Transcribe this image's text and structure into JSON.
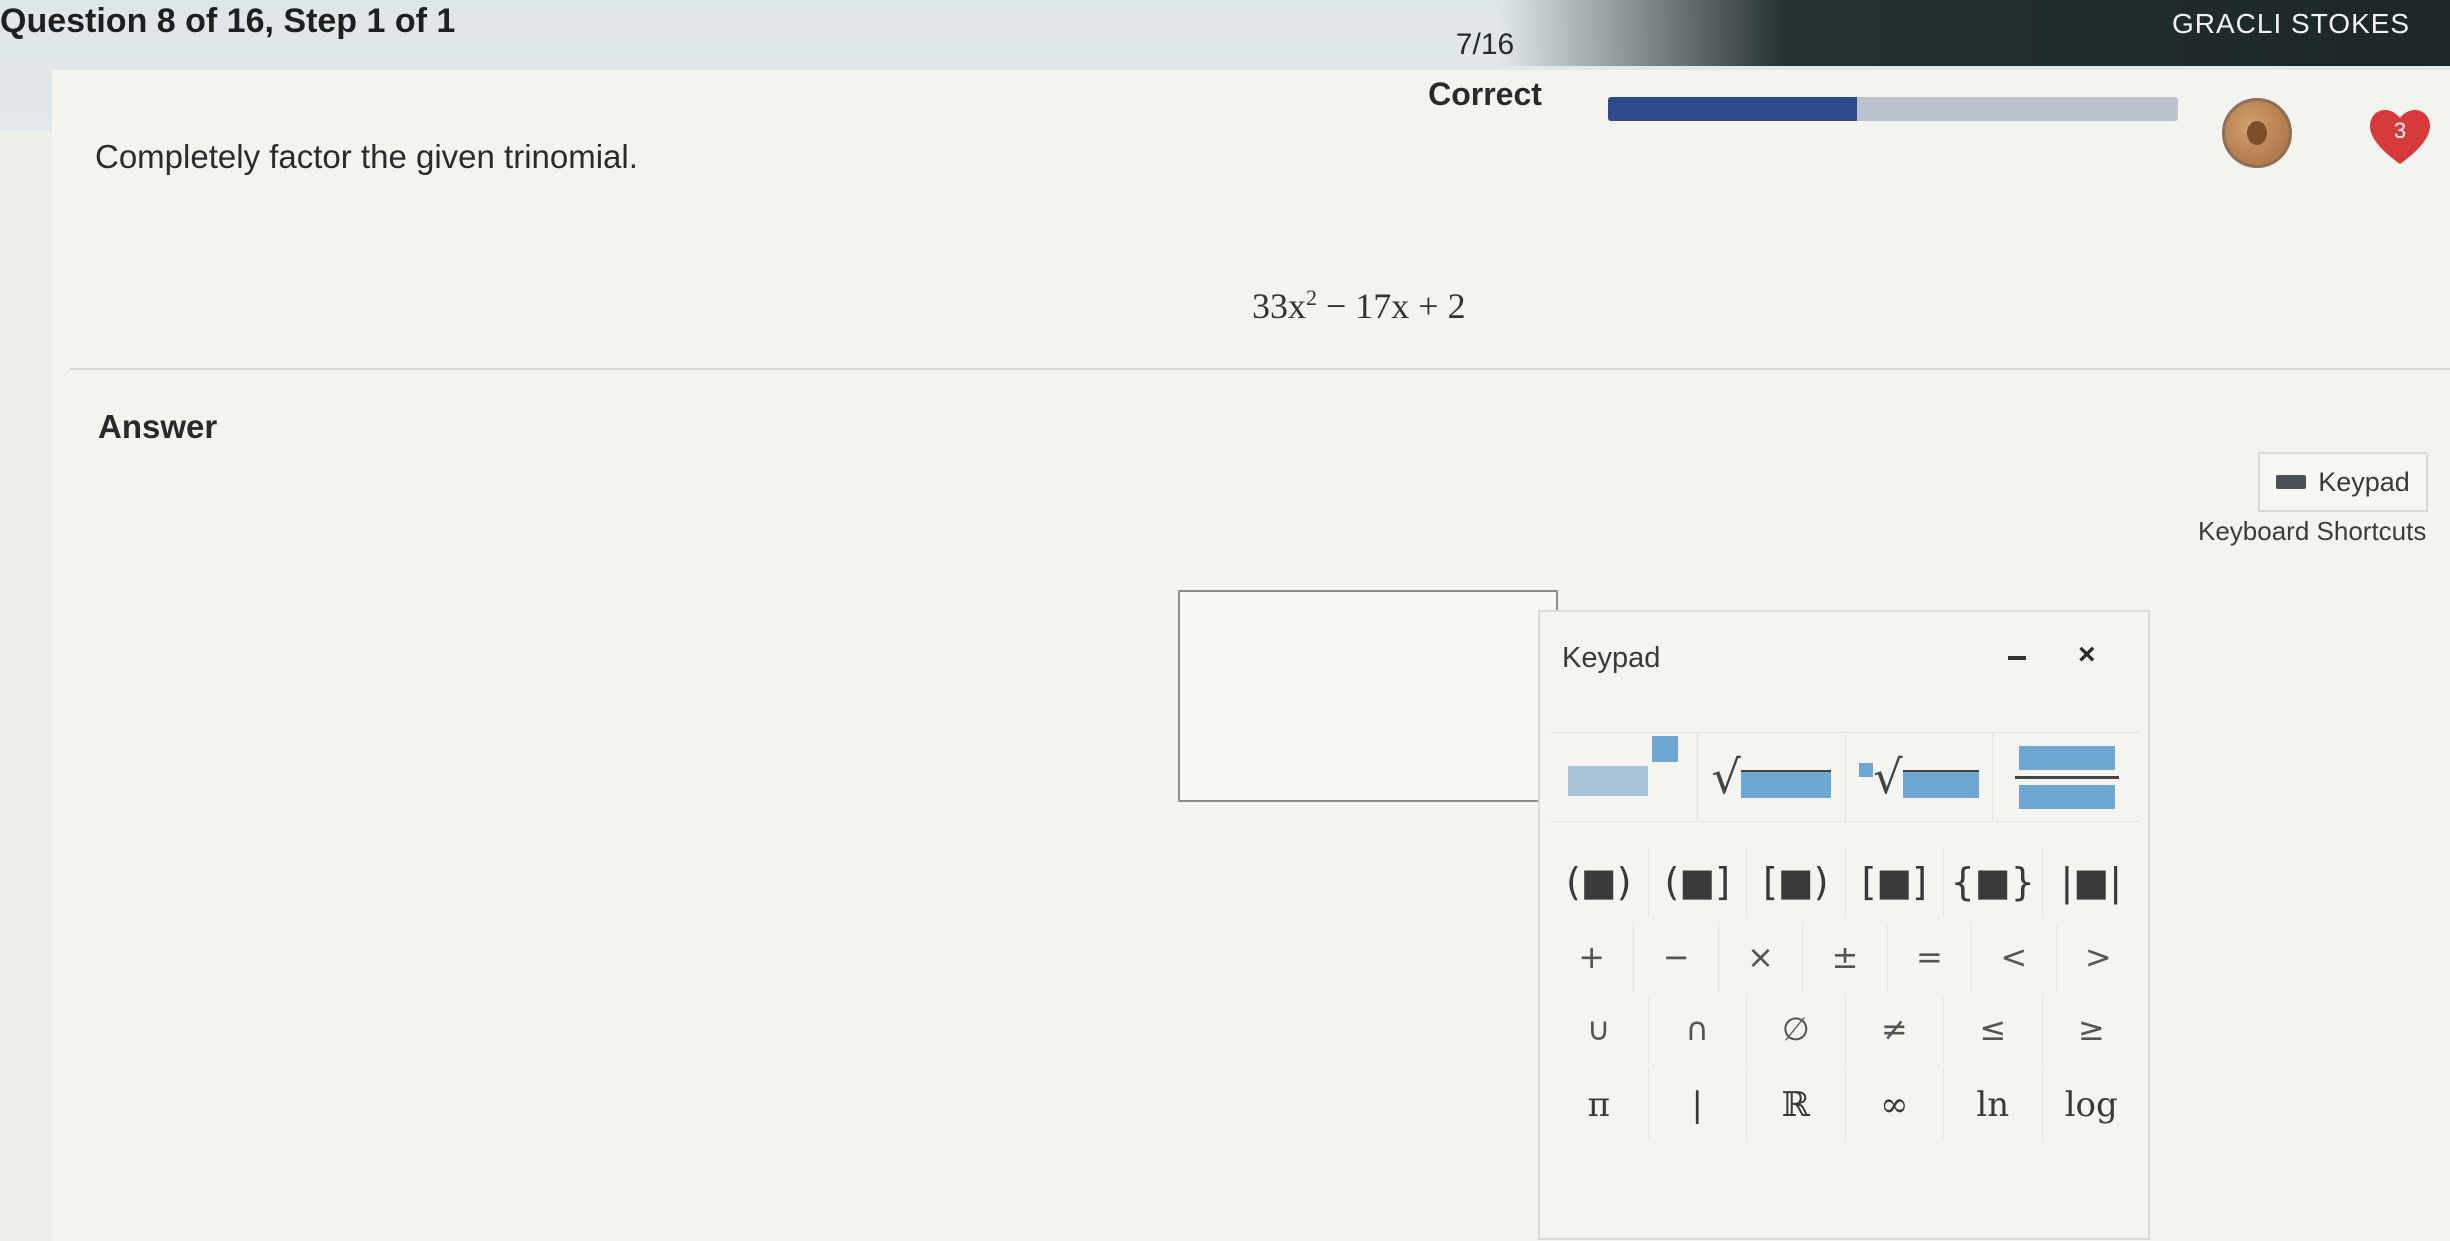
{
  "header": {
    "question_label": "Question 8 of 16, Step 1 of 1",
    "user_name": "GRACLI STOKES",
    "score_fraction": "7/16",
    "score_status": "Correct",
    "progress_fraction": 0.4375,
    "heart_count": "3",
    "colors": {
      "progress": "#2c4a8c",
      "heart": "#d63a3a",
      "coin": "#b07a4c"
    }
  },
  "question": {
    "prompt": "Completely factor the given trinomial.",
    "expression": {
      "coef": "33x",
      "exponent": "2",
      "rest": " − 17x + 2"
    }
  },
  "answer": {
    "heading": "Answer",
    "keypad_toggle": "Keypad",
    "shortcuts_link": "Keyboard Shortcuts",
    "input_value": ""
  },
  "keypad": {
    "title": "Keypad",
    "template_keys": [
      "exponent-icon",
      "sqrt-icon",
      "nth-root-icon",
      "fraction-icon"
    ],
    "grouping_keys": [
      "(■)",
      "(■]",
      "[■)",
      "[■]",
      "{■}",
      "|■|"
    ],
    "operator_keys": [
      "+",
      "−",
      "×",
      "±",
      "=",
      "<",
      ">"
    ],
    "set_keys": [
      "∪",
      "∩",
      "∅",
      "≠",
      "≤",
      "≥"
    ],
    "constant_keys": [
      "π",
      "|",
      "ℝ",
      "∞",
      "ln",
      "log"
    ]
  }
}
